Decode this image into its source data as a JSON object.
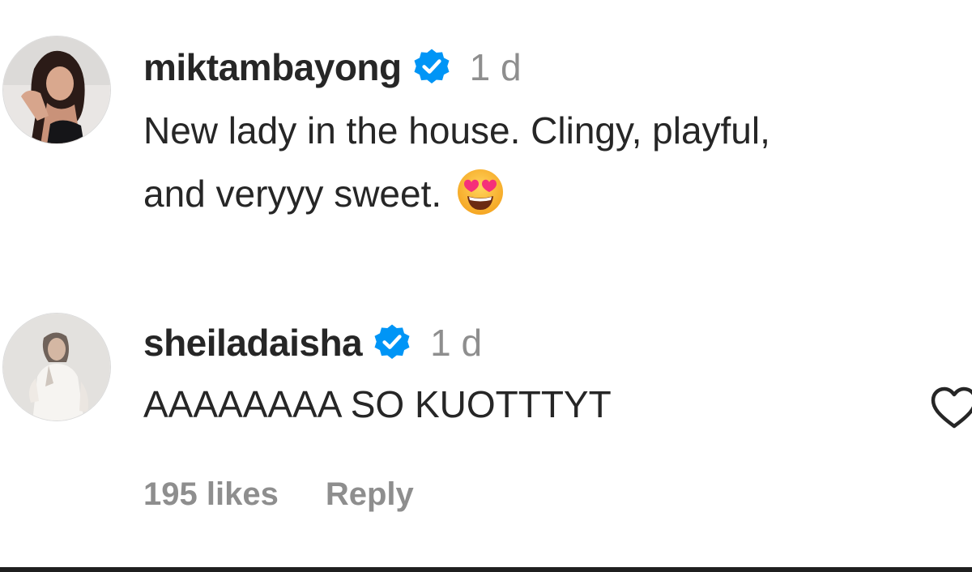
{
  "comments": [
    {
      "username": "miktambayong",
      "verified": true,
      "time": "1 d",
      "text_line_1": "New lady in the house. Clingy, playful,",
      "text_line_2": "and veryyy sweet.",
      "emoji": "smiling-face-with-heart-eyes"
    },
    {
      "username": "sheiladaisha",
      "verified": true,
      "time": "1 d",
      "text": "AAAAAAAA SO KUOTTTYT",
      "likes": "195 likes",
      "reply": "Reply",
      "like_icon": "heart-outline-icon"
    }
  ],
  "colors": {
    "username": "#262626",
    "muted": "#8e8e8e",
    "verified_blue": "#0095f6"
  }
}
